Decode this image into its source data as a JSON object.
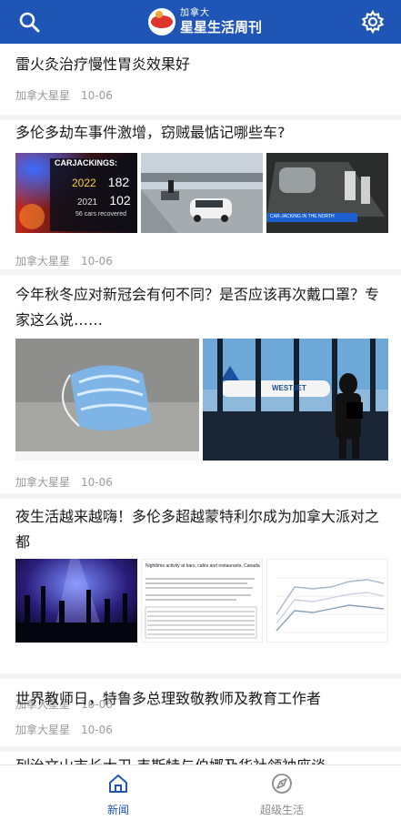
{
  "app": {
    "logo_small": "加拿大",
    "logo_big": "星星生活周刊",
    "brand_color": "#1f56b5"
  },
  "header": {
    "search_icon": "search-icon",
    "settings_icon": "gear-icon"
  },
  "articles": [
    {
      "title": "雷火灸治疗慢性胃炎效果好",
      "source": "加拿大星星",
      "date": "10-06"
    },
    {
      "title": "多伦多劫车事件激增，窃贼最惦记哪些车?",
      "source": "加拿大星星",
      "date": "10-06",
      "images": [
        {
          "name": "carjacking-stats-image",
          "headline": "CARJACKINGS:",
          "rows": [
            [
              "2022",
              "182"
            ],
            [
              "2021",
              "102"
            ]
          ],
          "footer": "56 cars recovered"
        },
        {
          "name": "parking-lot-image"
        },
        {
          "name": "cctv-garage-image",
          "caption": "CAR-JACKING IN THE NORTH"
        }
      ]
    },
    {
      "title": "今年秋冬应对新冠会有何不同？是否应该再次戴口罩？专家这么说……",
      "source": "加拿大星星",
      "date": "10-06",
      "images": [
        {
          "name": "discarded-mask-image"
        },
        {
          "name": "airport-traveler-image",
          "plane_label": "WESTJET"
        }
      ]
    },
    {
      "title": "夜生活越来越嗨！多伦多超越蒙特利尔成为加拿大派对之都",
      "source": "加拿大星星",
      "date": "10-06",
      "images": [
        {
          "name": "concert-crowd-image"
        },
        {
          "name": "nightlife-report-image",
          "heading": "Nighttime activity at bars, cafés and restaurants, Canada"
        },
        {
          "name": "nightlife-chart-image"
        }
      ]
    },
    {
      "title": "世界教师日，特鲁多总理致敬教师及教育工作者",
      "source": "加拿大星星",
      "date": "10-06"
    },
    {
      "title": "列治文山市长大卫·韦斯特与伯娜及华社领袖座谈",
      "source": "",
      "date": ""
    }
  ],
  "bottom_nav": {
    "tabs": [
      {
        "label": "新闻",
        "icon": "home-icon",
        "active": true
      },
      {
        "label": "超级生活",
        "icon": "compass-icon",
        "active": false
      }
    ],
    "active_color": "#1f56b5",
    "inactive_color": "#8a8a8a"
  }
}
